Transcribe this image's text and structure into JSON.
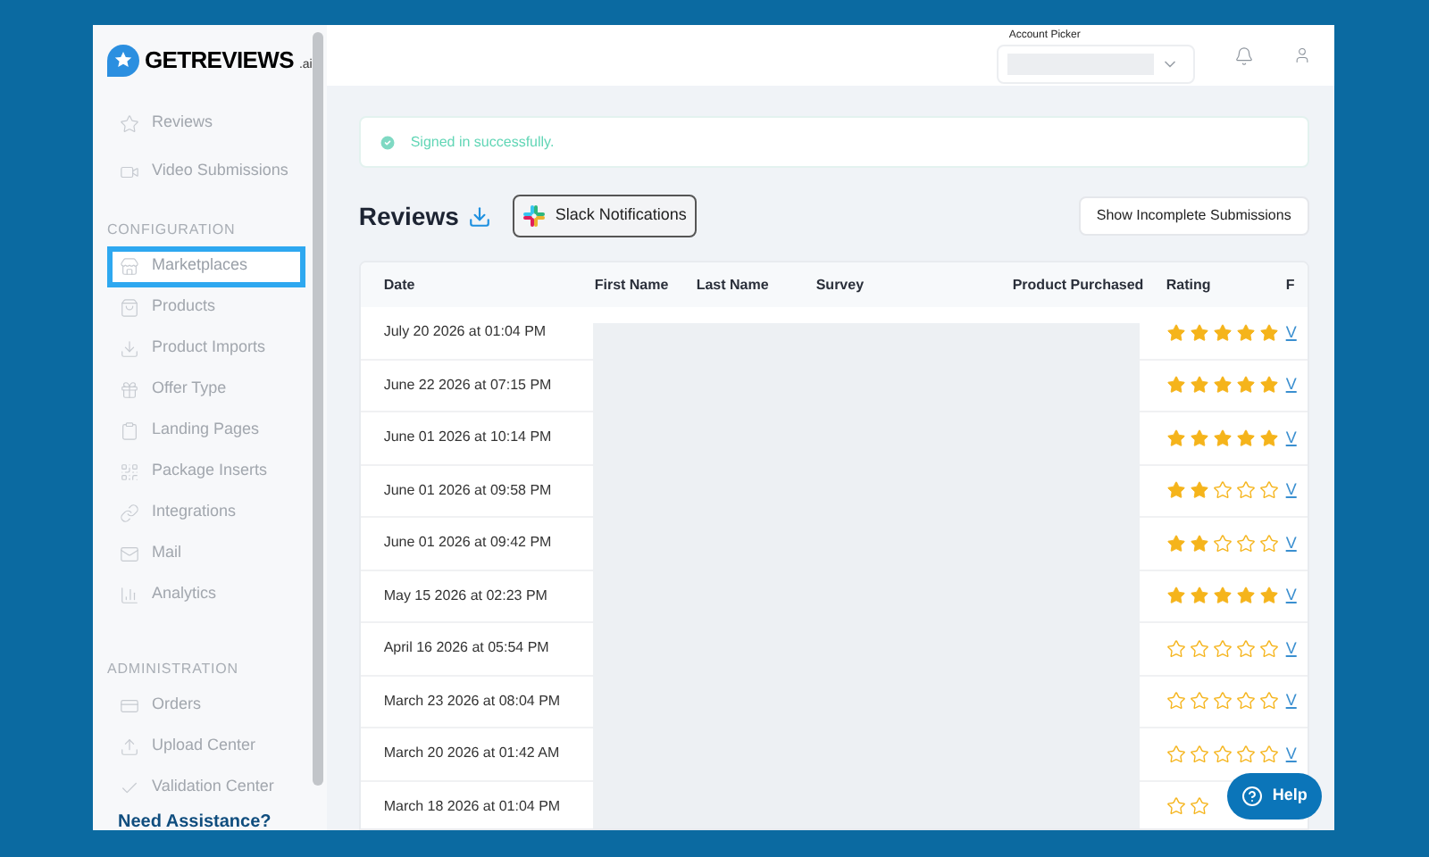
{
  "sidebar": {
    "logo": {
      "name": "GETREVIEWS",
      "suffix": ".ai"
    },
    "sections": [
      {
        "items": [
          {
            "label": "Reviews",
            "selected": false
          },
          {
            "label": "Video Submissions",
            "selected": false
          }
        ]
      },
      {
        "heading": "CONFIGURATION",
        "items": [
          {
            "label": "Marketplaces",
            "selected": true
          },
          {
            "label": "Products",
            "selected": false
          },
          {
            "label": "Product Imports",
            "selected": false
          },
          {
            "label": "Offer Type",
            "selected": false
          },
          {
            "label": "Landing Pages",
            "selected": false
          },
          {
            "label": "Package Inserts",
            "selected": false
          },
          {
            "label": "Integrations",
            "selected": false
          },
          {
            "label": "Mail",
            "selected": false
          },
          {
            "label": "Analytics",
            "selected": false
          }
        ]
      },
      {
        "heading": "ADMINISTRATION",
        "items": [
          {
            "label": "Orders",
            "selected": false
          },
          {
            "label": "Upload Center",
            "selected": false
          },
          {
            "label": "Validation Center",
            "selected": false
          }
        ]
      }
    ],
    "footer": "Need Assistance?"
  },
  "topbar": {
    "account_picker": {
      "label": "Account Picker"
    }
  },
  "alert": {
    "message": "Signed in successfully."
  },
  "page": {
    "title": "Reviews",
    "slack_button": "Slack Notifications",
    "incomplete_button": "Show Incomplete Submissions"
  },
  "table": {
    "columns": [
      "Date",
      "First Name",
      "Last Name",
      "Survey",
      "Product Purchased",
      "Rating",
      "F"
    ],
    "rows": [
      {
        "date": "July 20 2026 at 01:04 PM",
        "stars": 5,
        "link": "V"
      },
      {
        "date": "June 22 2026 at 07:15 PM",
        "stars": 5,
        "link": "V"
      },
      {
        "date": "June 01 2026 at 10:14 PM",
        "stars": 5,
        "link": "V"
      },
      {
        "date": "June 01 2026 at 09:58 PM",
        "stars": 2,
        "link": "V"
      },
      {
        "date": "June 01 2026 at 09:42 PM",
        "stars": 2,
        "link": "V"
      },
      {
        "date": "May 15 2026 at 02:23 PM",
        "stars": 5,
        "link": "V"
      },
      {
        "date": "April 16 2026 at 05:54 PM",
        "stars": 0,
        "link": "V"
      },
      {
        "date": "March 23 2026 at 08:04 PM",
        "stars": 0,
        "link": "V"
      },
      {
        "date": "March 20 2026 at 01:42 AM",
        "stars": 0,
        "link": "V"
      },
      {
        "date": "March 18 2026 at 01:04 PM"
      }
    ]
  },
  "help_button": "Help"
}
